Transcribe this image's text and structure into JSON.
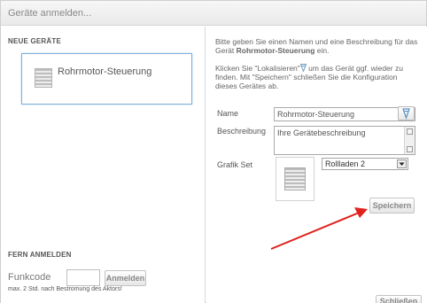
{
  "window": {
    "title": "Geräte anmelden..."
  },
  "left": {
    "new_devices_heading": "NEUE GERÄTE",
    "device_card_label": "Rohrmotor-Steuerung",
    "remote_heading": "FERN ANMELDEN",
    "funkcode_label": "Funkcode",
    "funkcode_value": "",
    "register_button": "Anmelden",
    "hint": "max. 2 Std. nach Bestromung des Aktors!"
  },
  "right": {
    "intro1_prefix": "Bitte geben Sie einen Namen und eine Beschreibung für das Gerät ",
    "intro1_bold": "Rohrmotor-Steuerung",
    "intro1_suffix": " ein.",
    "intro2_prefix": "Klicken Sie \"Lokalisieren\"",
    "intro2_suffix": " um das Gerät ggf. wieder zu finden. Mit \"Speichern\" schließen Sie die Konfiguration dieses Gerätes ab.",
    "name_label": "Name",
    "name_value": "Rohrmotor-Steuerung",
    "description_label": "Beschreibung",
    "description_value": "Ihre Gerätebeschreibung",
    "grafik_label": "Grafik Set",
    "grafik_selected": "Rollladen 2",
    "save_button": "Speichern"
  },
  "footer": {
    "close_button": "Schließen"
  },
  "icons": {
    "locate": "locate-icon",
    "shade": "roller-shutter-icon",
    "arrow": "red-arrow-annotation"
  },
  "colors": {
    "accent_border": "#7fb0d8",
    "annotation": "#e0211c"
  }
}
